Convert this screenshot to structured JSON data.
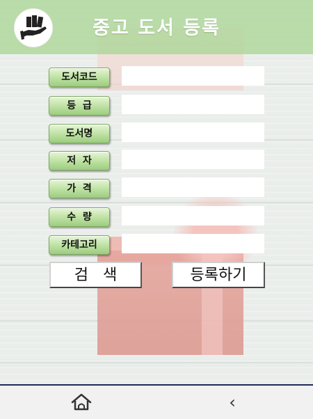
{
  "header": {
    "title": "중고 도서 등록",
    "logo_icon": "hand-holding-books-icon"
  },
  "form": {
    "fields": [
      {
        "label": "도서코드",
        "value": ""
      },
      {
        "label": "등  급",
        "value": ""
      },
      {
        "label": "도서명",
        "value": ""
      },
      {
        "label": "저  자",
        "value": ""
      },
      {
        "label": "가  격",
        "value": ""
      },
      {
        "label": "수  량",
        "value": ""
      },
      {
        "label": "카테고리",
        "value": ""
      }
    ]
  },
  "actions": {
    "search_label": "검   색",
    "register_label": "등록하기"
  },
  "navbar": {
    "home_icon": "home-icon",
    "back_label": "‹"
  },
  "colors": {
    "header": "#aad696",
    "label_button": "#bfe3a5",
    "navbar_border": "#222a5a"
  }
}
